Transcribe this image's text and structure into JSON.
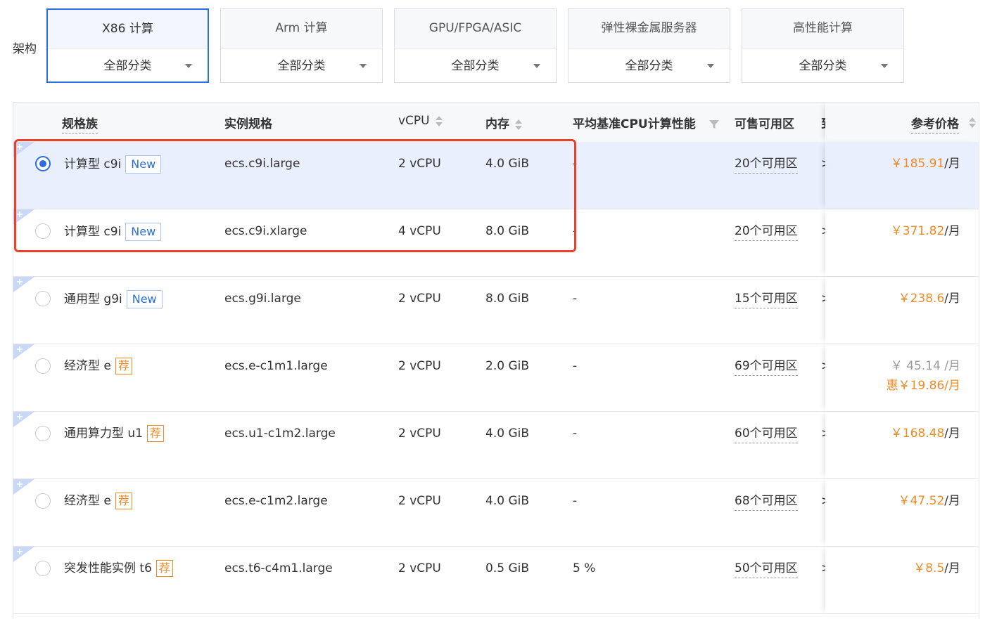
{
  "arch_label": "架构",
  "tabs": [
    {
      "title": "X86 计算",
      "select": "全部分类"
    },
    {
      "title": "Arm 计算",
      "select": "全部分类"
    },
    {
      "title": "GPU/FPGA/ASIC",
      "select": "全部分类"
    },
    {
      "title": "弹性裸金属服务器",
      "select": "全部分类"
    },
    {
      "title": "高性能计算",
      "select": "全部分类"
    }
  ],
  "active_tab_index": 0,
  "table": {
    "headers": {
      "family": "规格族",
      "spec": "实例规格",
      "vcpu": "vCPU",
      "memory": "内存",
      "perf": "平均基准CPU计算性能",
      "zones": "可售可用区",
      "more": "到",
      "price": "参考价格"
    },
    "rows": [
      {
        "family": "计算型 c9i",
        "badge": "New",
        "badge_type": "new",
        "spec": "ecs.c9i.large",
        "vcpu": "2 vCPU",
        "memory": "4.0 GiB",
        "perf": "-",
        "zones": "20个可用区",
        "more": ">",
        "price": "￥185.91",
        "unit": "/月",
        "selected": true
      },
      {
        "family": "计算型 c9i",
        "badge": "New",
        "badge_type": "new",
        "spec": "ecs.c9i.xlarge",
        "vcpu": "4 vCPU",
        "memory": "8.0 GiB",
        "perf": "-",
        "zones": "20个可用区",
        "more": ">",
        "price": "￥371.82",
        "unit": "/月",
        "selected": false
      },
      {
        "family": "通用型 g9i",
        "badge": "New",
        "badge_type": "new",
        "spec": "ecs.g9i.large",
        "vcpu": "2 vCPU",
        "memory": "8.0 GiB",
        "perf": "-",
        "zones": "15个可用区",
        "more": ">",
        "price": "￥238.6",
        "unit": "/月",
        "selected": false
      },
      {
        "family": "经济型 e",
        "badge": "荐",
        "badge_type": "rec",
        "spec": "ecs.e-c1m1.large",
        "vcpu": "2 vCPU",
        "memory": "2.0 GiB",
        "perf": "-",
        "zones": "69个可用区",
        "more": ">",
        "price_old": "￥ 45.14 /月",
        "price_discount": "惠￥19.86/月",
        "selected": false
      },
      {
        "family": "通用算力型 u1",
        "badge": "荐",
        "badge_type": "rec",
        "spec": "ecs.u1-c1m2.large",
        "vcpu": "2 vCPU",
        "memory": "4.0 GiB",
        "perf": "-",
        "zones": "60个可用区",
        "more": ">",
        "price": "￥168.48",
        "unit": "/月",
        "selected": false
      },
      {
        "family": "经济型 e",
        "badge": "荐",
        "badge_type": "rec",
        "spec": "ecs.e-c1m2.large",
        "vcpu": "2 vCPU",
        "memory": "4.0 GiB",
        "perf": "-",
        "zones": "68个可用区",
        "more": ">",
        "price": "￥47.52",
        "unit": "/月",
        "selected": false
      },
      {
        "family": "突发性能实例 t6",
        "badge": "荐",
        "badge_type": "rec",
        "spec": "ecs.t6-c4m1.large",
        "vcpu": "2 vCPU",
        "memory": "0.5 GiB",
        "perf": "5 %",
        "zones": "50个可用区",
        "more": ">",
        "price": "￥8.5",
        "unit": "/月",
        "selected": false
      }
    ]
  },
  "colors": {
    "accent": "#2a6ee0",
    "price": "#f08a24",
    "highlight": "#e8412c",
    "selected_row": "#e9effd"
  }
}
